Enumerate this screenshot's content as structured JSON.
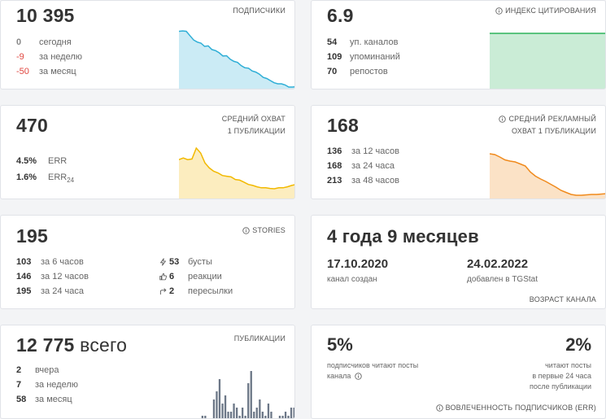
{
  "subscribers": {
    "value": "10 395",
    "label": "ПОДПИСЧИКИ",
    "rows": [
      {
        "value": "0",
        "text": "сегодня"
      },
      {
        "value": "-9",
        "text": "за неделю"
      },
      {
        "value": "-50",
        "text": "за месяц"
      }
    ],
    "trend": [
      46,
      46.2,
      46,
      44,
      42,
      41,
      40.5,
      39,
      39.2,
      37.5,
      37,
      36,
      34.5,
      34.6,
      33,
      32,
      31.5,
      30,
      29,
      28.8,
      27.5,
      27,
      26,
      24.5,
      24,
      23,
      22,
      21.5,
      21.5,
      21,
      20,
      20,
      20.2
    ]
  },
  "citation": {
    "value": "6.9",
    "label": "ИНДЕКС ЦИТИРОВАНИЯ",
    "rows": [
      {
        "value": "54",
        "text": "уп. каналов"
      },
      {
        "value": "109",
        "text": "упоминаний"
      },
      {
        "value": "70",
        "text": "репостов"
      }
    ],
    "trend": [
      6.9,
      6.9,
      6.9,
      6.9,
      6.9,
      6.9,
      6.9,
      6.9,
      6.9,
      6.9,
      6.9,
      6.9
    ]
  },
  "reach": {
    "value": "470",
    "label_line1": "СРЕДНИЙ ОХВАТ",
    "label_line2": "1 ПУБЛИКАЦИИ",
    "rows": [
      {
        "value": "4.5%",
        "text": "ERR"
      },
      {
        "value": "1.6%",
        "text": "ERR",
        "sub": "24"
      }
    ],
    "trend": [
      540,
      545,
      540,
      542,
      575,
      560,
      530,
      515,
      505,
      500,
      492,
      490,
      488,
      480,
      478,
      472,
      465,
      462,
      458,
      455,
      455,
      453,
      452,
      455,
      455,
      458,
      462,
      465
    ]
  },
  "ad_reach": {
    "value": "168",
    "label_line1": "СРЕДНИЙ РЕКЛАМНЫЙ",
    "label_line2": "ОХВАТ 1 ПУБЛИКАЦИИ",
    "rows": [
      {
        "value": "136",
        "text": "за 12 часов"
      },
      {
        "value": "168",
        "text": "за 24 часа"
      },
      {
        "value": "213",
        "text": "за 48 часов"
      }
    ],
    "trend": [
      240,
      238,
      232,
      225,
      222,
      220,
      215,
      210,
      195,
      185,
      178,
      172,
      165,
      158,
      150,
      145,
      140,
      138,
      138,
      139,
      140,
      140,
      141,
      142
    ]
  },
  "stories": {
    "value": "195",
    "label": "STORIES",
    "left_rows": [
      {
        "value": "103",
        "text": "за 6 часов"
      },
      {
        "value": "146",
        "text": "за 12 часов"
      },
      {
        "value": "195",
        "text": "за 24 часа"
      }
    ],
    "right_rows": [
      {
        "icon": "boost-icon",
        "value": "53",
        "text": "бусты"
      },
      {
        "icon": "thumb-up-icon",
        "value": "6",
        "text": "реакции"
      },
      {
        "icon": "forward-icon",
        "value": "2",
        "text": "пересылки"
      }
    ]
  },
  "age": {
    "value": "4 года 9 месяцев",
    "created_date": "17.10.2020",
    "created_label": "канал создан",
    "added_date": "24.02.2022",
    "added_label": "добавлен в TGStat",
    "label": "ВОЗРАСТ КАНАЛА"
  },
  "posts": {
    "value": "12 775",
    "unit": "всего",
    "label": "ПУБЛИКАЦИИ",
    "rows": [
      {
        "value": "2",
        "text": "вчера"
      },
      {
        "value": "7",
        "text": "за неделю"
      },
      {
        "value": "58",
        "text": "за месяц"
      }
    ],
    "bars": [
      0,
      0,
      0,
      0,
      0,
      0,
      0,
      1,
      1,
      0,
      0,
      5,
      7,
      10,
      4,
      6,
      2,
      2,
      4,
      3,
      1,
      3,
      1,
      9,
      12,
      2,
      3,
      5,
      2,
      1,
      4,
      2,
      0,
      0,
      1,
      1,
      2,
      1,
      3,
      3
    ]
  },
  "engagement": {
    "left_value": "5%",
    "left_text_line1": "подписчиков читают посты",
    "left_text_line2": "канала",
    "right_value": "2%",
    "right_text_line1": "читают посты",
    "right_text_line2": "в первые 24 часа",
    "right_text_line3": "после публикации",
    "label": "ВОВЛЕЧЕННОСТЬ ПОДПИСЧИКОВ (ERR)"
  },
  "colors": {
    "subscribers": "#2eaed6",
    "citation": "#2db45a",
    "reach": "#f2b900",
    "ad_reach": "#f08a1c",
    "posts": "#6c7787",
    "negative": "#e0463f"
  }
}
